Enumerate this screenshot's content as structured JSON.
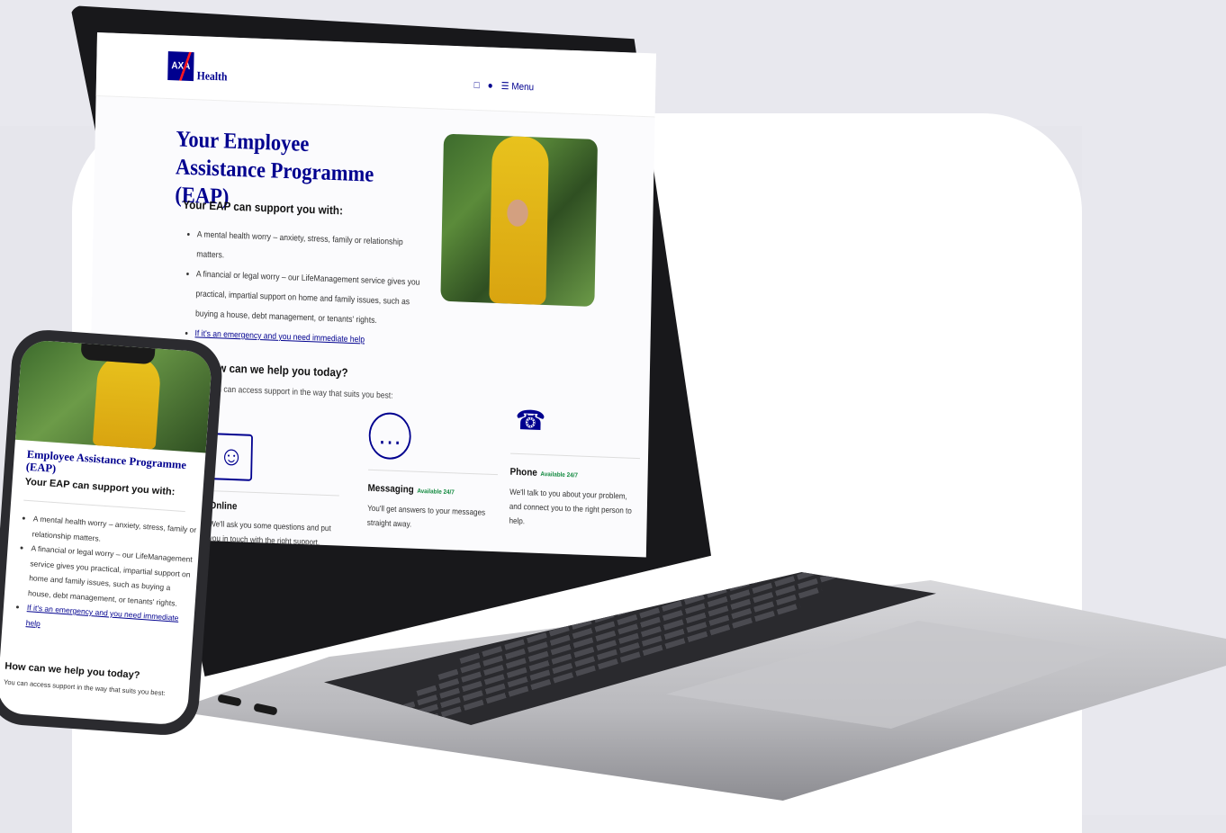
{
  "brand": {
    "logo_text": "AXA",
    "name": "Health"
  },
  "nav": {
    "menu_label": "Menu",
    "calendar_icon": "calendar-icon",
    "profile_icon": "person-icon",
    "menu_icon": "hamburger-icon"
  },
  "desktop": {
    "title": "Your Employee Assistance Programme (EAP)",
    "support_heading": "Your EAP can support you with:",
    "bullets": [
      "A mental health worry – anxiety, stress, family or relationship matters.",
      "A financial or legal worry – our LifeManagement service gives you practical, impartial support on home and family issues, such as buying a house, debt management, or tenants' rights."
    ],
    "emergency_link": "If it's an emergency and you need immediate help",
    "help_heading": "How can we help you today?",
    "help_subtext": "You can access support in the way that suits you best:",
    "options": [
      {
        "name": "Online",
        "availability": "",
        "description": "We'll ask you some questions and put you in touch with the right support.",
        "icon": "computer-user-icon"
      },
      {
        "name": "Messaging",
        "availability": "Available 24/7",
        "description": "You'll get answers to your messages straight away.",
        "icon": "chat-bubble-icon"
      },
      {
        "name": "Phone",
        "availability": "Available 24/7",
        "description": "We'll talk to you about your problem, and connect you to the right person to help.",
        "icon": "phone-icon"
      }
    ]
  },
  "mobile": {
    "title": "Employee Assistance Programme (EAP)",
    "support_heading": "Your EAP can support you with:",
    "bullets": [
      "A mental health worry – anxiety, stress, family or relationship matters.",
      "A financial or legal worry – our LifeManagement service gives you practical, impartial support on home and family issues, such as buying a house, debt management, or tenants' rights."
    ],
    "emergency_link": "If it's an emergency and you need immediate help",
    "help_heading": "How can we help you today?",
    "help_subtext": "You can access support in the way that suits you best:"
  },
  "colors": {
    "brand_blue": "#00008f",
    "brand_red": "#ff1721",
    "available_green": "#128a3f"
  }
}
